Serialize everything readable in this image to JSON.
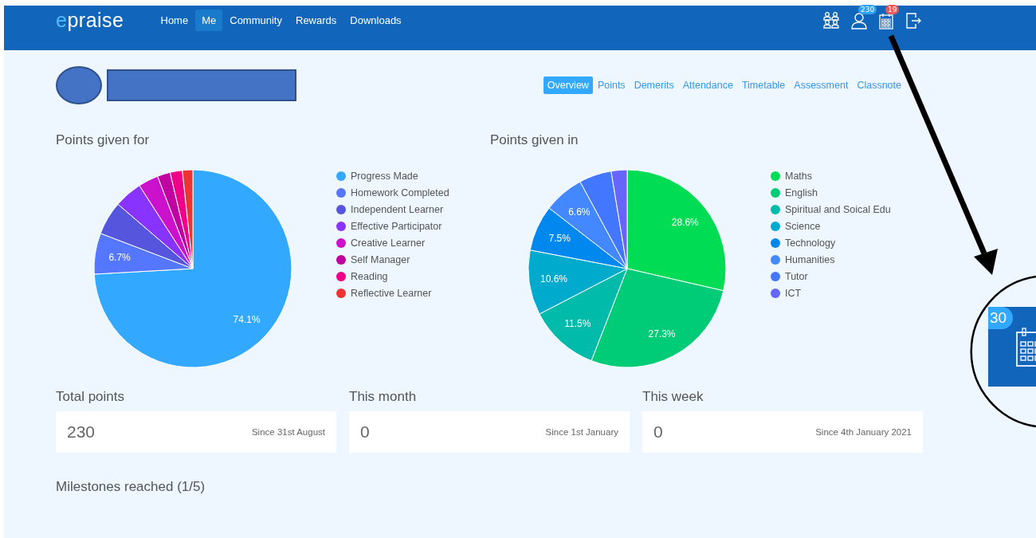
{
  "header": {
    "logo": {
      "accent": "e",
      "text": "praise"
    },
    "nav": [
      {
        "label": "Home",
        "selected": false
      },
      {
        "label": "Me",
        "selected": true
      },
      {
        "label": "Community",
        "selected": false
      },
      {
        "label": "Rewards",
        "selected": false
      },
      {
        "label": "Downloads",
        "selected": false
      }
    ],
    "icons": [
      {
        "kind": "people"
      },
      {
        "kind": "person",
        "badge": "230",
        "color": "#2fa3f5"
      },
      {
        "kind": "calendar",
        "badge": "19",
        "color": "#ee5555"
      },
      {
        "kind": "logout"
      }
    ]
  },
  "profile_tabs": [
    {
      "label": "Overview",
      "selected": true
    },
    {
      "label": "Points",
      "selected": false
    },
    {
      "label": "Demerits",
      "selected": false
    },
    {
      "label": "Attendance",
      "selected": false
    },
    {
      "label": "Timetable",
      "selected": false
    },
    {
      "label": "Assessment",
      "selected": false
    },
    {
      "label": "Classnote",
      "selected": false
    }
  ],
  "charts": [
    {
      "title": "Points given for",
      "chart_data": {
        "type": "pie",
        "categories": [
          "Progress Made",
          "Homework Completed",
          "Independent Learner",
          "Effective Participator",
          "Creative Learner",
          "Self Manager",
          "Reading",
          "Reflective Learner"
        ],
        "values": [
          74.1,
          6.7,
          5.5,
          4.6,
          3.3,
          2.1,
          2.0,
          1.7
        ],
        "colors": [
          "#33a8ff",
          "#5577ff",
          "#5555dd",
          "#8833ff",
          "#cc11cc",
          "#c000a0",
          "#ee0088",
          "#ee3333"
        ],
        "value_labels": [
          "74.1%",
          "6.7%",
          null,
          null,
          null,
          null,
          null,
          null
        ]
      }
    },
    {
      "title": "Points given in",
      "chart_data": {
        "type": "pie",
        "categories": [
          "Maths",
          "English",
          "Spiritual and Soical Edu",
          "Science",
          "Technology",
          "Humanities",
          "Tutor",
          "ICT"
        ],
        "values": [
          28.6,
          27.3,
          11.5,
          10.6,
          7.5,
          6.6,
          5.3,
          2.6
        ],
        "colors": [
          "#00dd55",
          "#00cc77",
          "#00bbaa",
          "#00aacc",
          "#0088ee",
          "#4488ff",
          "#4477ff",
          "#6666ff"
        ],
        "value_labels": [
          "28.6%",
          "27.3%",
          "11.5%",
          "10.6%",
          "7.5%",
          "6.6%",
          null,
          null
        ]
      }
    }
  ],
  "stats": [
    {
      "title": "Total points",
      "value": "230",
      "since": "Since 31st August"
    },
    {
      "title": "This month",
      "value": "0",
      "since": "Since 1st January"
    },
    {
      "title": "This week",
      "value": "0",
      "since": "Since 4th January 2021"
    }
  ],
  "milestones": "Milestones reached (1/5)",
  "inset": {
    "badge": "30"
  }
}
